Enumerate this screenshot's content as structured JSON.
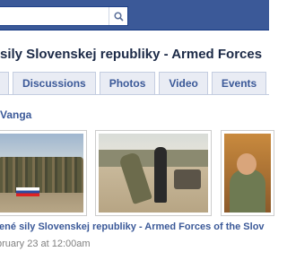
{
  "search": {
    "value": "",
    "placeholder": ""
  },
  "page": {
    "title": "sily Slovenskej republiky - Armed Forces"
  },
  "tabs": [
    {
      "label": "Discussions"
    },
    {
      "label": "Photos"
    },
    {
      "label": "Video"
    },
    {
      "label": "Events"
    }
  ],
  "post": {
    "author": "Vanga",
    "caption": "jené sily Slovenskej republiky - Armed Forces of the Slov",
    "timestamp": "bruary 23 at 12:00am"
  },
  "colors": {
    "topbar": "#3b5998",
    "link": "#3b5998",
    "tab_bg": "#e9ecf4",
    "title": "#1c2a47"
  },
  "icons": {
    "search": "magnifier"
  }
}
